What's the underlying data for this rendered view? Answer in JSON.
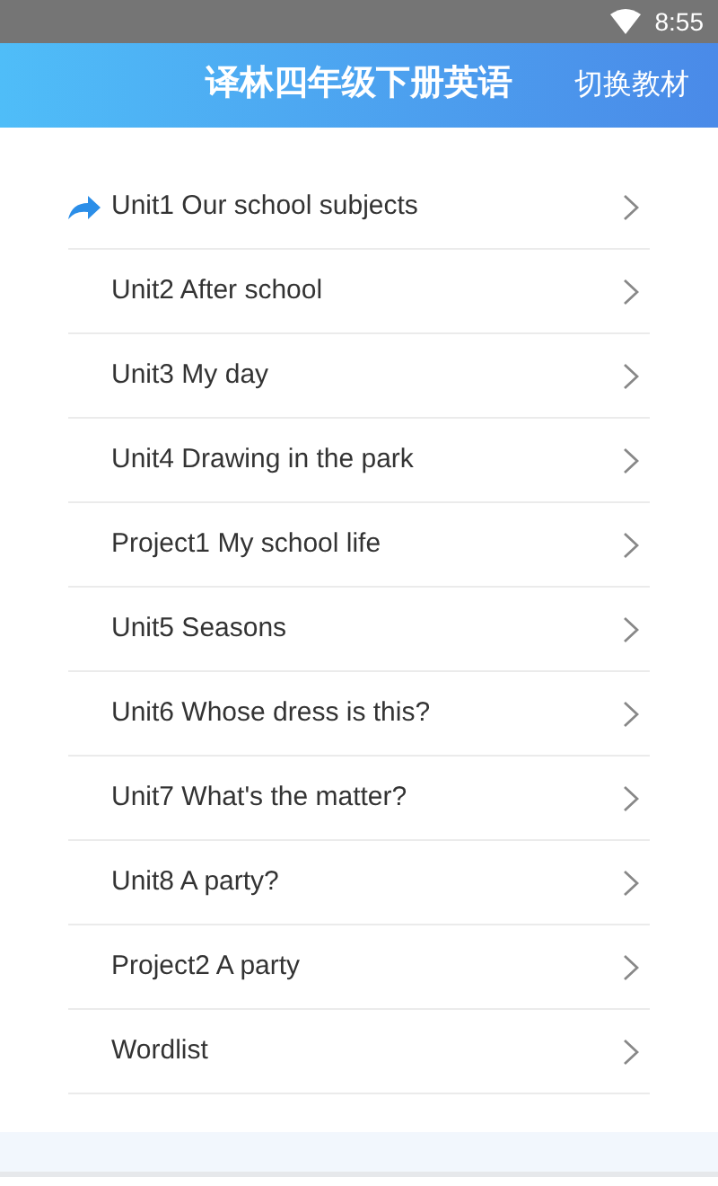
{
  "status_bar": {
    "time": "8:55"
  },
  "header": {
    "title": "译林四年级下册英语",
    "action": "切换教材"
  },
  "units": [
    {
      "label": "Unit1 Our school subjects",
      "selected": true
    },
    {
      "label": "Unit2 After school",
      "selected": false
    },
    {
      "label": "Unit3 My day",
      "selected": false
    },
    {
      "label": "Unit4 Drawing in the park",
      "selected": false
    },
    {
      "label": "Project1 My school life",
      "selected": false
    },
    {
      "label": "Unit5 Seasons",
      "selected": false
    },
    {
      "label": "Unit6 Whose dress is this?",
      "selected": false
    },
    {
      "label": "Unit7 What's the matter?",
      "selected": false
    },
    {
      "label": "Unit8 A party?",
      "selected": false
    },
    {
      "label": "Project2 A party",
      "selected": false
    },
    {
      "label": "Wordlist",
      "selected": false
    }
  ]
}
